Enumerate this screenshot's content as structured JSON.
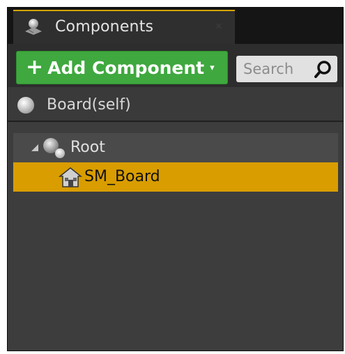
{
  "window": {
    "tab_title": "Components",
    "tab_icon": "components-icon",
    "close_icon": "close-icon",
    "accent_color": "#d7a700"
  },
  "toolbar": {
    "add_button_label": "Add Component",
    "add_button_color": "#3fa83f",
    "add_button_plus": "+",
    "add_button_caret": "▾",
    "search_placeholder": "Search",
    "search_value": ""
  },
  "self_row": {
    "label": "Board(self)",
    "icon": "sphere-icon"
  },
  "tree": {
    "items": [
      {
        "label": "Root",
        "icon": "scene-root-icon",
        "expanded": true,
        "selected": false
      },
      {
        "label": "SM_Board",
        "icon": "static-mesh-icon",
        "selected": true,
        "highlight_color": "#d99d00"
      }
    ]
  }
}
